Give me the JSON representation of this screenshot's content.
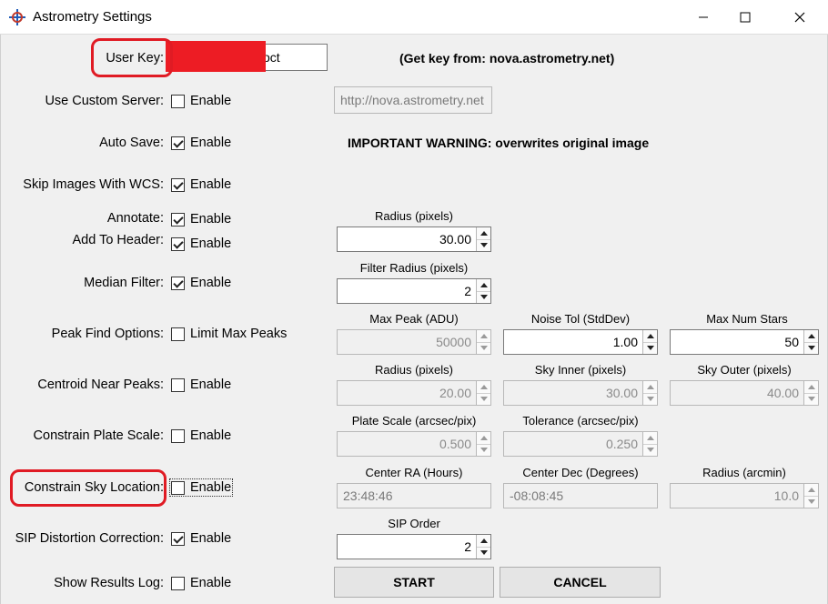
{
  "window": {
    "title": "Astrometry Settings"
  },
  "user_key": {
    "label": "User Key:",
    "value_visible": "oct",
    "hint_prefix": "(Get key from:",
    "hint_link": "nova.astrometry.net)"
  },
  "custom_server": {
    "label": "Use Custom Server:",
    "enable": "Enable",
    "checked": false,
    "url": "http://nova.astrometry.net"
  },
  "auto_save": {
    "label": "Auto Save:",
    "enable": "Enable",
    "checked": true,
    "warning_bold": "IMPORTANT WARNING:",
    "warning_text": "overwrites original image"
  },
  "skip_wcs": {
    "label": "Skip Images With WCS:",
    "enable": "Enable",
    "checked": true
  },
  "annotate": {
    "label": "Annotate:",
    "enable": "Enable",
    "checked": true,
    "radius_caption": "Radius (pixels)",
    "radius_value": "30.00"
  },
  "add_header": {
    "label": "Add To Header:",
    "enable": "Enable",
    "checked": true
  },
  "median_filter": {
    "label": "Median Filter:",
    "enable": "Enable",
    "checked": true,
    "caption": "Filter Radius (pixels)",
    "value": "2"
  },
  "peak_find": {
    "label": "Peak Find Options:",
    "enable": "Limit Max Peaks",
    "checked": false,
    "max_peak_caption": "Max Peak (ADU)",
    "max_peak_value": "50000",
    "noise_tol_caption": "Noise Tol (StdDev)",
    "noise_tol_value": "1.00",
    "max_stars_caption": "Max Num Stars",
    "max_stars_value": "50"
  },
  "centroid": {
    "label": "Centroid Near Peaks:",
    "enable": "Enable",
    "checked": false,
    "radius_caption": "Radius (pixels)",
    "radius_value": "20.00",
    "sky_inner_caption": "Sky Inner (pixels)",
    "sky_inner_value": "30.00",
    "sky_outer_caption": "Sky Outer (pixels)",
    "sky_outer_value": "40.00"
  },
  "plate_scale": {
    "label": "Constrain Plate Scale:",
    "enable": "Enable",
    "checked": false,
    "scale_caption": "Plate Scale (arcsec/pix)",
    "scale_value": "0.500",
    "tol_caption": "Tolerance (arcsec/pix)",
    "tol_value": "0.250"
  },
  "sky_location": {
    "label": "Constrain Sky Location:",
    "enable": "Enable",
    "checked": false,
    "ra_caption": "Center RA (Hours)",
    "ra_value": "23:48:46",
    "dec_caption": "Center Dec (Degrees)",
    "dec_value": "-08:08:45",
    "radius_caption": "Radius (arcmin)",
    "radius_value": "10.0"
  },
  "sip": {
    "label": "SIP Distortion Correction:",
    "enable": "Enable",
    "checked": true,
    "caption": "SIP Order",
    "value": "2"
  },
  "results_log": {
    "label": "Show Results Log:",
    "enable": "Enable",
    "checked": false
  },
  "buttons": {
    "start": "START",
    "cancel": "CANCEL"
  },
  "colors": {
    "annotation_red": "#e01b24"
  }
}
